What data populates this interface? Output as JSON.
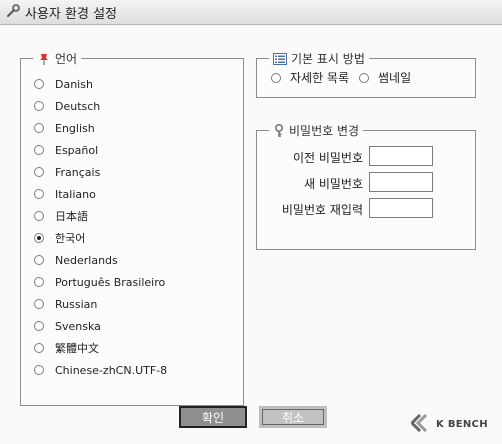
{
  "window": {
    "title": "사용자 환경 설정"
  },
  "language": {
    "legend": "언어",
    "selected_index": 8,
    "items": [
      "Danish",
      "Deutsch",
      "English",
      "Español",
      "Français",
      "Italiano",
      "日本語",
      "한국어",
      "Nederlands",
      "Português Brasileiro",
      "Russian",
      "Svenska",
      "繁體中文",
      "Chinese-zhCN.UTF-8"
    ]
  },
  "display": {
    "legend": "기본 표시 방법",
    "options": [
      "자세한 목록",
      "썸네일"
    ]
  },
  "password": {
    "legend": "비밀번호 변경",
    "current_label": "이전 비밀번호",
    "new_label": "새 비밀번호",
    "confirm_label": "비밀번호 재입력",
    "current_value": "",
    "new_value": "",
    "confirm_value": ""
  },
  "buttons": {
    "ok": "확인",
    "cancel": "취소"
  },
  "brand": {
    "name": "K BENCH"
  }
}
